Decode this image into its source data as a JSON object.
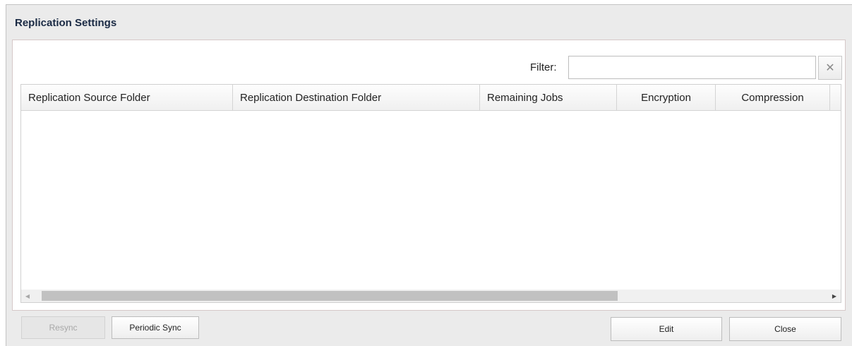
{
  "dialog": {
    "title": "Replication Settings"
  },
  "filter": {
    "label": "Filter:",
    "value": "",
    "placeholder": "",
    "clear_symbol": "✕"
  },
  "grid": {
    "columns": [
      "Replication Source Folder",
      "Replication Destination Folder",
      "Remaining Jobs",
      "Encryption",
      "Compression"
    ],
    "rows": []
  },
  "scrollbar": {
    "left_arrow": "◀",
    "right_arrow": "▶"
  },
  "footer": {
    "resync_label": "Resync",
    "periodic_sync_label": "Periodic Sync",
    "edit_label": "Edit",
    "close_label": "Close"
  }
}
